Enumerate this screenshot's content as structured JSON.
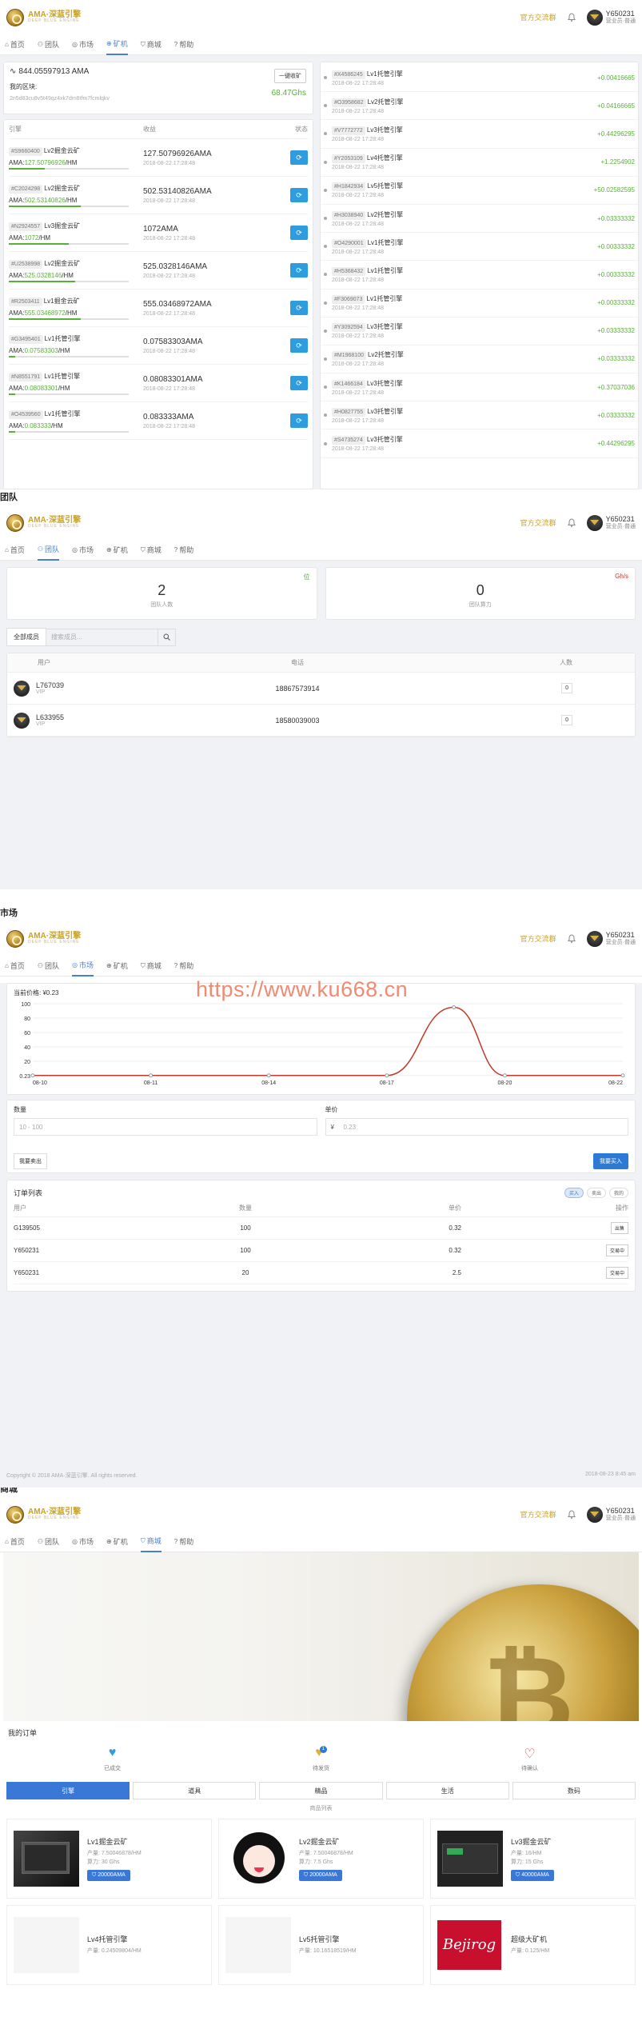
{
  "header": {
    "logo_text": "AMA·深蓝引擎",
    "logo_sub": "DEEP BLUE ENGINE",
    "exchange_link": "官方交流群",
    "user_id": "Y650231",
    "user_role": "营业员·普通"
  },
  "nav": [
    "首页",
    "团队",
    "市场",
    "矿机",
    "商城",
    "帮助"
  ],
  "mining": {
    "balance": "844.05597913 AMA",
    "collect_btn": "一键收矿",
    "addr_label": "我的区块:",
    "addr": "2n5d83cu8v5t49qz4xk7dm8tfm7fcmlqkv",
    "power": "68.47Ghs",
    "headers": [
      "引擎",
      "收益",
      "状态"
    ],
    "rows": [
      {
        "tag": "#S9660400",
        "name": "Lv2掘金云矿",
        "ama": "127.50796926",
        "income": "127.50796926AMA",
        "time": "2018-08-22 17:28:48",
        "pct": 0.3
      },
      {
        "tag": "#C2024298",
        "name": "Lv2掘金云矿",
        "ama": "502.53140826",
        "income": "502.53140826AMA",
        "time": "2018-08-22 17:28:48",
        "pct": 0.6
      },
      {
        "tag": "#N2924557",
        "name": "Lv3掘金云矿",
        "ama": "1072",
        "income": "1072AMA",
        "time": "2018-08-22 17:28:48",
        "pct": 0.5
      },
      {
        "tag": "#U2538998",
        "name": "Lv2掘金云矿",
        "ama": "525.0328146",
        "income": "525.0328146AMA",
        "time": "2018-08-22 17:28:48",
        "pct": 0.55
      },
      {
        "tag": "#R2503411",
        "name": "Lv1掘金云矿",
        "ama": "555.03468972",
        "income": "555.03468972AMA",
        "time": "2018-08-22 17:28:48",
        "pct": 0.6
      },
      {
        "tag": "#G3495401",
        "name": "Lv1托管引擎",
        "ama": "0.07583303",
        "income": "0.07583303AMA",
        "time": "2018-08-22 17:28:48",
        "pct": 0.05
      },
      {
        "tag": "#N8551791",
        "name": "Lv1托管引擎",
        "ama": "0.08083301",
        "income": "0.08083301AMA",
        "time": "2018-08-22 17:28:48",
        "pct": 0.05
      },
      {
        "tag": "#O4539560",
        "name": "Lv1托管引擎",
        "ama": "0.083333",
        "income": "0.083333AMA",
        "time": "2018-08-22 17:28:48",
        "pct": 0.05
      }
    ],
    "ama_label": "AMA:",
    "unit": "/HM",
    "trans": [
      {
        "tag": "#X4586245",
        "name": "Lv1托管引擎",
        "time": "2018-08-22 17:28:48",
        "val": "+0.00416665"
      },
      {
        "tag": "#O3958682",
        "name": "Lv2托管引擎",
        "time": "2018-08-22 17:28:48",
        "val": "+0.04166665"
      },
      {
        "tag": "#V7772772",
        "name": "Lv3托管引擎",
        "time": "2018-08-22 17:28:48",
        "val": "+0.44296295"
      },
      {
        "tag": "#Y2053109",
        "name": "Lv4托管引擎",
        "time": "2018-08-22 17:28:48",
        "val": "+1.2254902"
      },
      {
        "tag": "#H1842934",
        "name": "Lv5托管引擎",
        "time": "2018-08-22 17:28:48",
        "val": "+50.02582595"
      },
      {
        "tag": "#H3038940",
        "name": "Lv2托管引擎",
        "time": "2018-08-22 17:28:48",
        "val": "+0.03333332"
      },
      {
        "tag": "#O4290001",
        "name": "Lv1托管引擎",
        "time": "2018-08-22 17:28:48",
        "val": "+0.00333332"
      },
      {
        "tag": "#H5368432",
        "name": "Lv1托管引擎",
        "time": "2018-08-22 17:28:48",
        "val": "+0.00333332"
      },
      {
        "tag": "#F3069073",
        "name": "Lv1托管引擎",
        "time": "2018-08-22 17:28:48",
        "val": "+0.00333332"
      },
      {
        "tag": "#Y3092594",
        "name": "Lv3托管引擎",
        "time": "2018-08-22 17:28:48",
        "val": "+0.03333332"
      },
      {
        "tag": "#M1968100",
        "name": "Lv2托管引擎",
        "time": "2018-08-22 17:28:48",
        "val": "+0.03333332"
      },
      {
        "tag": "#K1466184",
        "name": "Lv3托管引擎",
        "time": "2018-08-22 17:28:48",
        "val": "+0.37037036"
      },
      {
        "tag": "#H0827755",
        "name": "Lv3托管引擎",
        "time": "2018-08-22 17:28:48",
        "val": "+0.03333332"
      },
      {
        "tag": "#S4735274",
        "name": "Lv3托管引擎",
        "time": "2018-08-22 17:28:48",
        "val": "+0.44296295"
      }
    ]
  },
  "team": {
    "section_label": "团队",
    "count": "2",
    "count_label": "团队人数",
    "count_unit": "位",
    "power": "0",
    "power_label": "团队算力",
    "power_unit": "Gh/s",
    "filter_btn": "全部成员",
    "search_placeholder": "搜索成员...",
    "headers": [
      "用户",
      "电话",
      "人数"
    ],
    "rows": [
      {
        "name": "L767039",
        "vip": "VIP",
        "phone": "18867573914",
        "count": "0"
      },
      {
        "name": "L633955",
        "vip": "VIP",
        "phone": "18580039003",
        "count": "0"
      }
    ]
  },
  "market": {
    "section_label": "市场",
    "watermark": "https://www.ku668.cn",
    "price_label": "当前价格: ¥0.23",
    "qty_label": "数量",
    "qty_placeholder": "10 - 100",
    "price_label2": "单价",
    "price_placeholder": "0.23",
    "yen": "¥",
    "sell_btn": "我要卖出",
    "buy_btn": "我要买入",
    "orders_title": "订单列表",
    "order_tabs": [
      "买入",
      "卖出",
      "我的"
    ],
    "order_headers": [
      "用户",
      "数量",
      "单价",
      "操作"
    ],
    "orders": [
      {
        "user": "G139505",
        "qty": "100",
        "price": "0.32",
        "op": "出售"
      },
      {
        "user": "Y650231",
        "qty": "100",
        "price": "0.32",
        "op": "交易中"
      },
      {
        "user": "Y650231",
        "qty": "20",
        "price": "2.5",
        "op": "交易中"
      }
    ],
    "footer_left": "Copyright © 2018 AMA·深蓝引擎. All rights reserved.",
    "footer_right": "2018-08-23 8:45 am"
  },
  "chart_data": {
    "type": "line",
    "x": [
      "08-10",
      "08-11",
      "08-14",
      "08-17",
      "08-20",
      "08-22"
    ],
    "y_ticks": [
      "100",
      "80",
      "60",
      "40",
      "20",
      "0.23"
    ],
    "series": [
      {
        "values": [
          0.23,
          0.23,
          0.23,
          0.3,
          95,
          0.23,
          0.23
        ]
      }
    ],
    "x_points": [
      "08-10",
      "08-11",
      "08-14",
      "08-17",
      "08-19",
      "08-20",
      "08-22"
    ],
    "ylim": [
      0,
      100
    ],
    "color": "#c0392b"
  },
  "shop": {
    "section_label": "商城",
    "myorders_title": "我的订单",
    "order_status": [
      {
        "label": "已成交",
        "icon": "heart-pulse-icon",
        "color": "#2d9de0"
      },
      {
        "label": "待发货",
        "icon": "heart-badge-icon",
        "color": "#e0b030",
        "badge": "1"
      },
      {
        "label": "待确认",
        "icon": "heart-outline-icon",
        "color": "#d04040"
      }
    ],
    "categories": [
      "引擎",
      "道具",
      "精品",
      "生活",
      "数码"
    ],
    "list_label": "商品列表",
    "goods": [
      {
        "name": "Lv1掘金云矿",
        "yield": "产量: 7.50046878/HM",
        "power": "算力: 30 Ghs",
        "price": "20000AMA",
        "img": "machine"
      },
      {
        "name": "Lv2掘金云矿",
        "yield": "产量: 7.50046878/HM",
        "power": "算力: 7.5 Ghs",
        "price": "20000AMA",
        "img": "girl"
      },
      {
        "name": "Lv3掘金云矿",
        "yield": "产量: 16/HM",
        "power": "算力: 15 Ghs",
        "price": "40000AMA",
        "img": "server"
      },
      {
        "name": "Lv4托管引擎",
        "yield": "产量: 0.24509804/HM",
        "power": "",
        "price": "",
        "img": "blank"
      },
      {
        "name": "Lv5托管引擎",
        "yield": "产量: 10.16518519/HM",
        "power": "",
        "price": "",
        "img": "blank"
      },
      {
        "name": "超级大矿机",
        "yield": "产量: 0.125/HM",
        "power": "",
        "price": "",
        "img": "logo"
      }
    ]
  }
}
